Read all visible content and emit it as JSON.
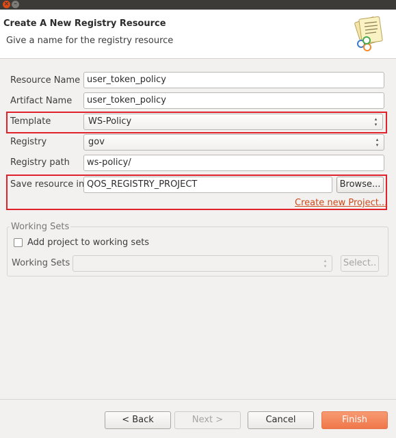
{
  "header": {
    "title": "Create A New Registry Resource",
    "description": "Give a name for the registry resource"
  },
  "form": {
    "resource_name_label": "Resource Name",
    "resource_name_value": "user_token_policy",
    "artifact_name_label": "Artifact Name",
    "artifact_name_value": "user_token_policy",
    "template_label": "Template",
    "template_value": "WS-Policy",
    "registry_label": "Registry",
    "registry_value": "gov",
    "registry_path_label": "Registry path",
    "registry_path_value": "ws-policy/",
    "save_resource_label": "Save resource in",
    "save_resource_value": "QOS_REGISTRY_PROJECT",
    "browse_label": "Browse...",
    "create_project_link": "Create new Project..."
  },
  "working_sets": {
    "group_title": "Working Sets",
    "add_checkbox_label": "Add project to working sets",
    "add_checkbox_checked": false,
    "working_sets_label": "Working Sets",
    "working_sets_value": "",
    "select_label": "Select.."
  },
  "footer": {
    "back_label": "< Back",
    "next_label": "Next >",
    "cancel_label": "Cancel",
    "finish_label": "Finish"
  },
  "colors": {
    "highlight": "#e0202a",
    "finish": "#f0774a",
    "link": "#cc4a1a"
  }
}
